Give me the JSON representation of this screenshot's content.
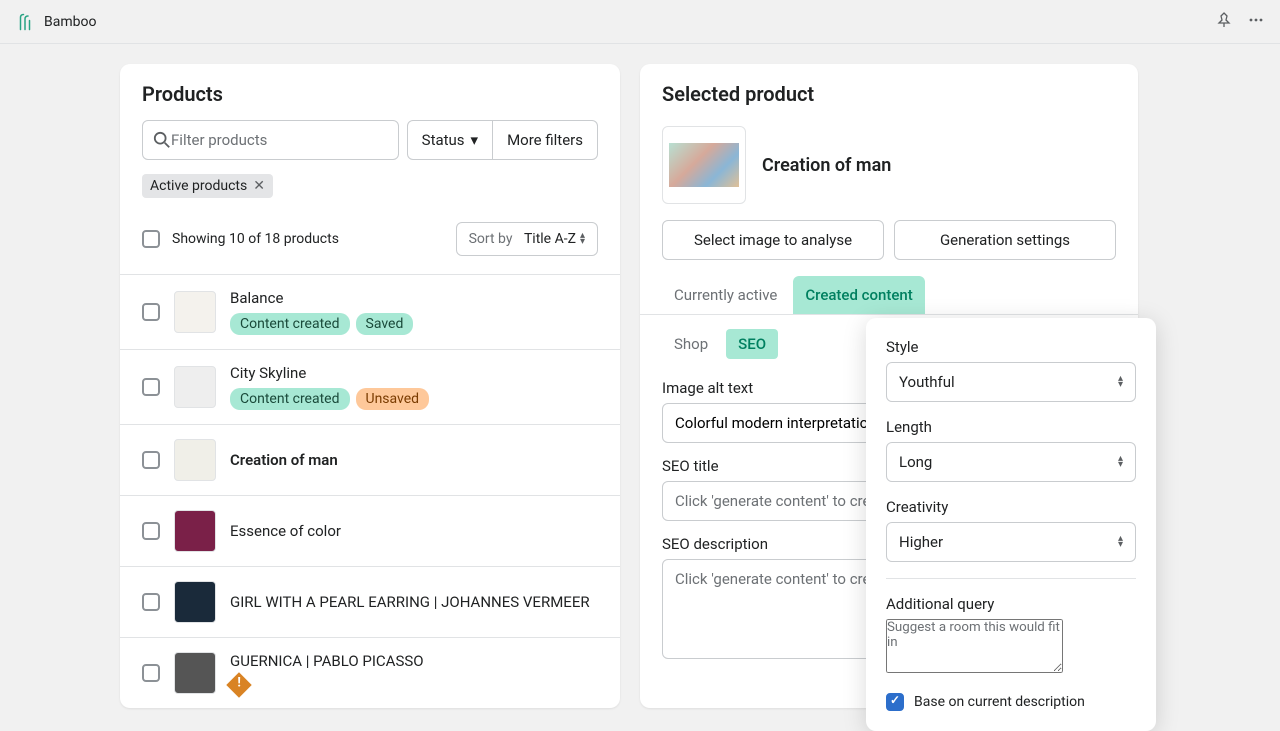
{
  "app": {
    "name": "Bamboo"
  },
  "products_panel": {
    "title": "Products",
    "search_placeholder": "Filter products",
    "status_btn": "Status",
    "more_filters_btn": "More filters",
    "active_chip": "Active products",
    "showing": "Showing 10 of 18 products",
    "sort_label": "Sort by",
    "sort_value": "Title A-Z"
  },
  "products": [
    {
      "title": "Balance",
      "bold": false,
      "tags": [
        {
          "text": "Content created",
          "kind": "green"
        },
        {
          "text": "Saved",
          "kind": "green"
        }
      ],
      "warn": false
    },
    {
      "title": "City Skyline",
      "bold": false,
      "tags": [
        {
          "text": "Content created",
          "kind": "green"
        },
        {
          "text": "Unsaved",
          "kind": "orange"
        }
      ],
      "warn": false
    },
    {
      "title": "Creation of man",
      "bold": true,
      "tags": [],
      "warn": false
    },
    {
      "title": "Essence of color",
      "bold": false,
      "tags": [],
      "warn": false
    },
    {
      "title": "GIRL WITH A PEARL EARRING | JOHANNES VERMEER",
      "bold": false,
      "tags": [],
      "warn": false
    },
    {
      "title": "GUERNICA | PABLO PICASSO",
      "bold": false,
      "tags": [],
      "warn": true
    }
  ],
  "detail": {
    "title": "Selected product",
    "product_name": "Creation of man",
    "select_image_btn": "Select image to analyse",
    "gen_settings_btn": "Generation settings",
    "tabs": [
      {
        "label": "Currently active",
        "active": false
      },
      {
        "label": "Created content",
        "active": true
      }
    ],
    "subtabs": [
      {
        "label": "Shop",
        "active": false
      },
      {
        "label": "SEO",
        "active": true
      }
    ],
    "alt_label": "Image alt text",
    "alt_value": "Colorful modern interpretation",
    "seo_title_label": "SEO title",
    "seo_title_placeholder": "Click 'generate content' to create",
    "seo_desc_label": "SEO description",
    "seo_desc_placeholder": "Click 'generate content' to create"
  },
  "settings": {
    "style_label": "Style",
    "style_value": "Youthful",
    "length_label": "Length",
    "length_value": "Long",
    "creativity_label": "Creativity",
    "creativity_value": "Higher",
    "addquery_label": "Additional query",
    "addquery_placeholder": "Suggest a room this would fit in",
    "base_label": "Base on current description"
  }
}
